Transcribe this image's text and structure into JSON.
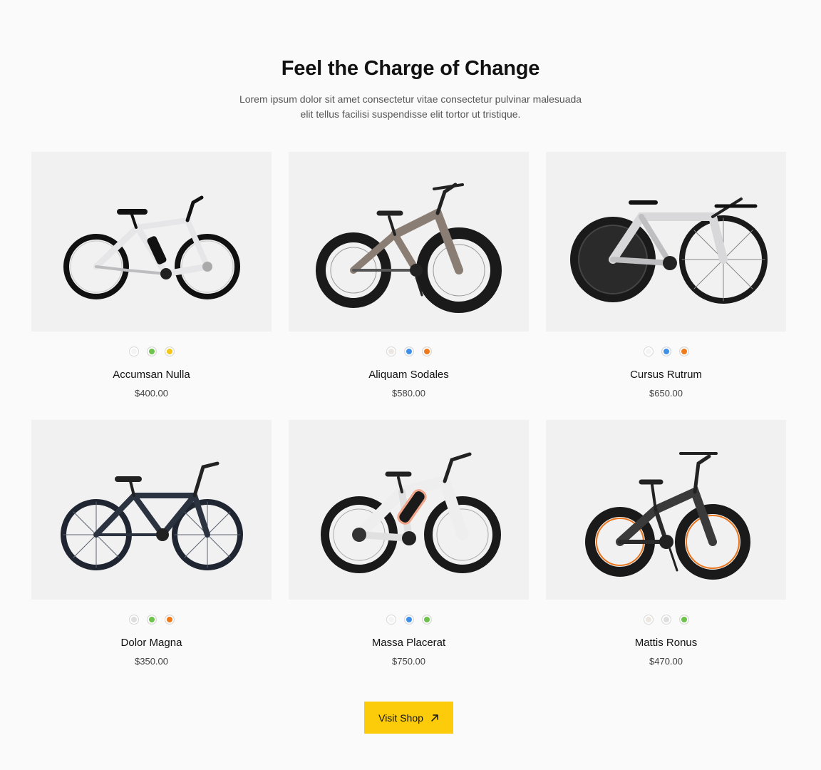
{
  "section": {
    "title": "Feel the Charge of Change",
    "subtitle_line1": "Lorem ipsum dolor sit amet consectetur vitae consectetur pulvinar malesuada",
    "subtitle_line2": "elit tellus facilisi suspendisse elit tortor ut tristique."
  },
  "products": [
    {
      "name": "Accumsan Nulla",
      "price": "$400.00",
      "swatches": [
        "#f4f4f4",
        "#6cc24a",
        "#f5c518"
      ],
      "frame_color": "#e6e6e8",
      "icon": "city-bike-icon"
    },
    {
      "name": "Aliquam Sodales",
      "price": "$580.00",
      "swatches": [
        "#ece6e0",
        "#3f8fe8",
        "#f07a1a"
      ],
      "frame_color": "#8a7e74",
      "icon": "fat-tire-ebike-icon"
    },
    {
      "name": "Cursus Rutrum",
      "price": "$650.00",
      "swatches": [
        "#f4f4f4",
        "#3f8fe8",
        "#f07a1a"
      ],
      "frame_color": "#d8d8da",
      "icon": "tri-bike-icon"
    },
    {
      "name": "Dolor Magna",
      "price": "$350.00",
      "swatches": [
        "#dedede",
        "#6cc24a",
        "#f07a1a"
      ],
      "frame_color": "#2b3340",
      "icon": "commuter-bike-icon"
    },
    {
      "name": "Massa Placerat",
      "price": "$750.00",
      "swatches": [
        "#f4f4f4",
        "#3f8fe8",
        "#6cc24a"
      ],
      "frame_color": "#eeeeee",
      "icon": "electric-mtb-icon"
    },
    {
      "name": "Mattis Ronus",
      "price": "$470.00",
      "swatches": [
        "#ece6e0",
        "#dedede",
        "#6cc24a"
      ],
      "frame_color": "#3a3a3a",
      "icon": "folding-ebike-icon"
    }
  ],
  "cta": {
    "label": "Visit Shop",
    "icon": "arrow-up-right-icon",
    "color": "#fccc0a"
  }
}
